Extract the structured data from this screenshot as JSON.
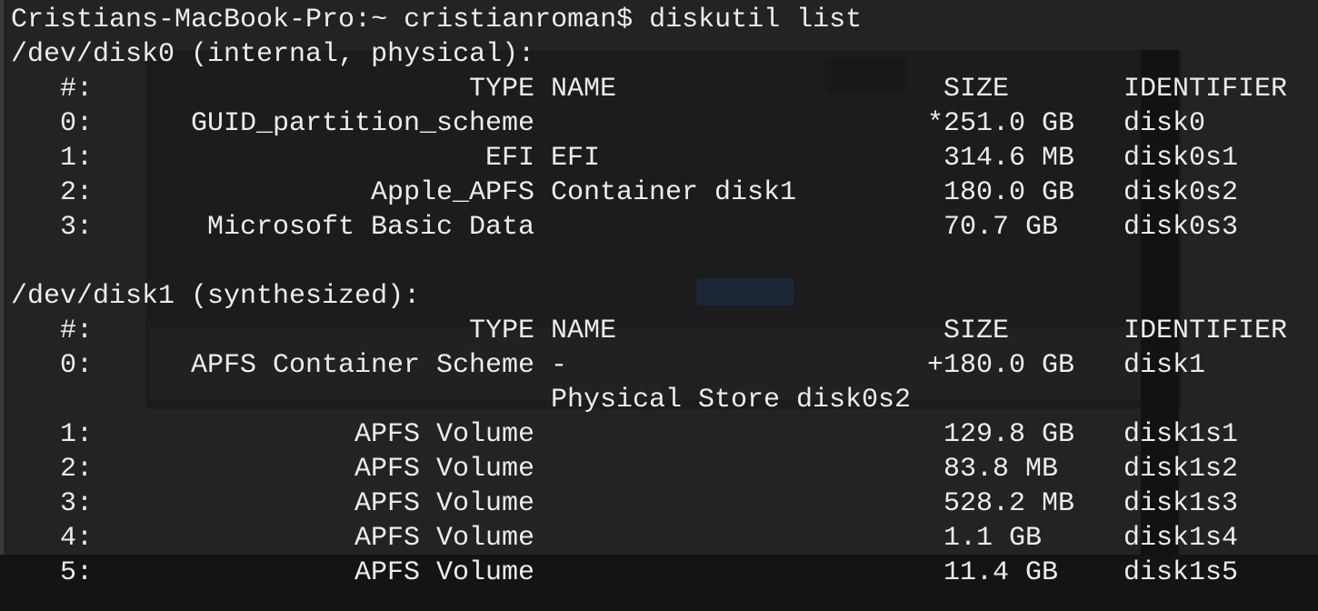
{
  "terminal": {
    "prompt": "Cristians-MacBook-Pro:~ cristianroman$ diskutil list",
    "headers": {
      "num": "#:",
      "type": "TYPE",
      "name": "NAME",
      "size": "SIZE",
      "identifier": "IDENTIFIER"
    },
    "disks": [
      {
        "title": "/dev/disk0 (internal, physical):",
        "partitions": [
          {
            "num": "0:",
            "type": "GUID_partition_scheme",
            "name": "",
            "size": "*251.0 GB",
            "identifier": "disk0"
          },
          {
            "num": "1:",
            "type": "EFI",
            "name": "EFI",
            "size": "314.6 MB",
            "identifier": "disk0s1"
          },
          {
            "num": "2:",
            "type": "Apple_APFS",
            "name": "Container disk1",
            "size": "180.0 GB",
            "identifier": "disk0s2"
          },
          {
            "num": "3:",
            "type": "Microsoft Basic Data",
            "name": "",
            "size": "70.7 GB",
            "identifier": "disk0s3"
          }
        ]
      },
      {
        "title": "/dev/disk1 (synthesized):",
        "partitions": [
          {
            "num": "0:",
            "type": "APFS Container Scheme",
            "name": "-",
            "size": "+180.0 GB",
            "identifier": "disk1",
            "note": "Physical Store disk0s2"
          },
          {
            "num": "1:",
            "type": "APFS Volume",
            "name": "",
            "size": "129.8 GB",
            "identifier": "disk1s1"
          },
          {
            "num": "2:",
            "type": "APFS Volume",
            "name": "",
            "size": "83.8 MB",
            "identifier": "disk1s2"
          },
          {
            "num": "3:",
            "type": "APFS Volume",
            "name": "",
            "size": "528.2 MB",
            "identifier": "disk1s3"
          },
          {
            "num": "4:",
            "type": "APFS Volume",
            "name": "",
            "size": "1.1 GB",
            "identifier": "disk1s4"
          },
          {
            "num": "5:",
            "type": "APFS Volume",
            "name": "",
            "size": "11.4 GB",
            "identifier": "disk1s5"
          }
        ]
      }
    ]
  },
  "colors": {
    "text": "#ececec",
    "background": "#232323"
  }
}
